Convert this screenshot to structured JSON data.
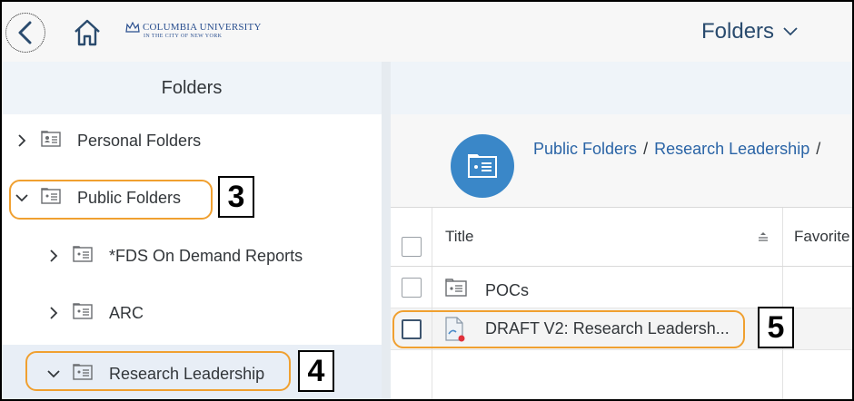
{
  "shell": {
    "logo_name": "COLUMBIA UNIVERSITY",
    "logo_sub": "IN THE CITY OF NEW YORK",
    "app_title": "Folders"
  },
  "left_pane": {
    "header": "Folders",
    "items": [
      {
        "label": "Personal Folders",
        "expanded": false
      },
      {
        "label": "Public Folders",
        "expanded": true
      },
      {
        "label": "*FDS On Demand Reports",
        "expanded": false
      },
      {
        "label": "ARC",
        "expanded": false
      },
      {
        "label": "Research Leadership",
        "expanded": true,
        "selected": true
      }
    ]
  },
  "breadcrumb": {
    "items": [
      "Public Folders",
      "Research Leadership"
    ],
    "separator": "/"
  },
  "table": {
    "columns": {
      "title": "Title",
      "favorites": "Favorite"
    },
    "rows": [
      {
        "title": "POCs",
        "type": "folder"
      },
      {
        "title": "DRAFT V2: Research Leadersh...",
        "type": "report"
      }
    ]
  },
  "callouts": [
    "3",
    "4",
    "5"
  ],
  "colors": {
    "highlight": "#f0a030",
    "link": "#2a64a6",
    "folder_circle": "#3a87c8"
  }
}
